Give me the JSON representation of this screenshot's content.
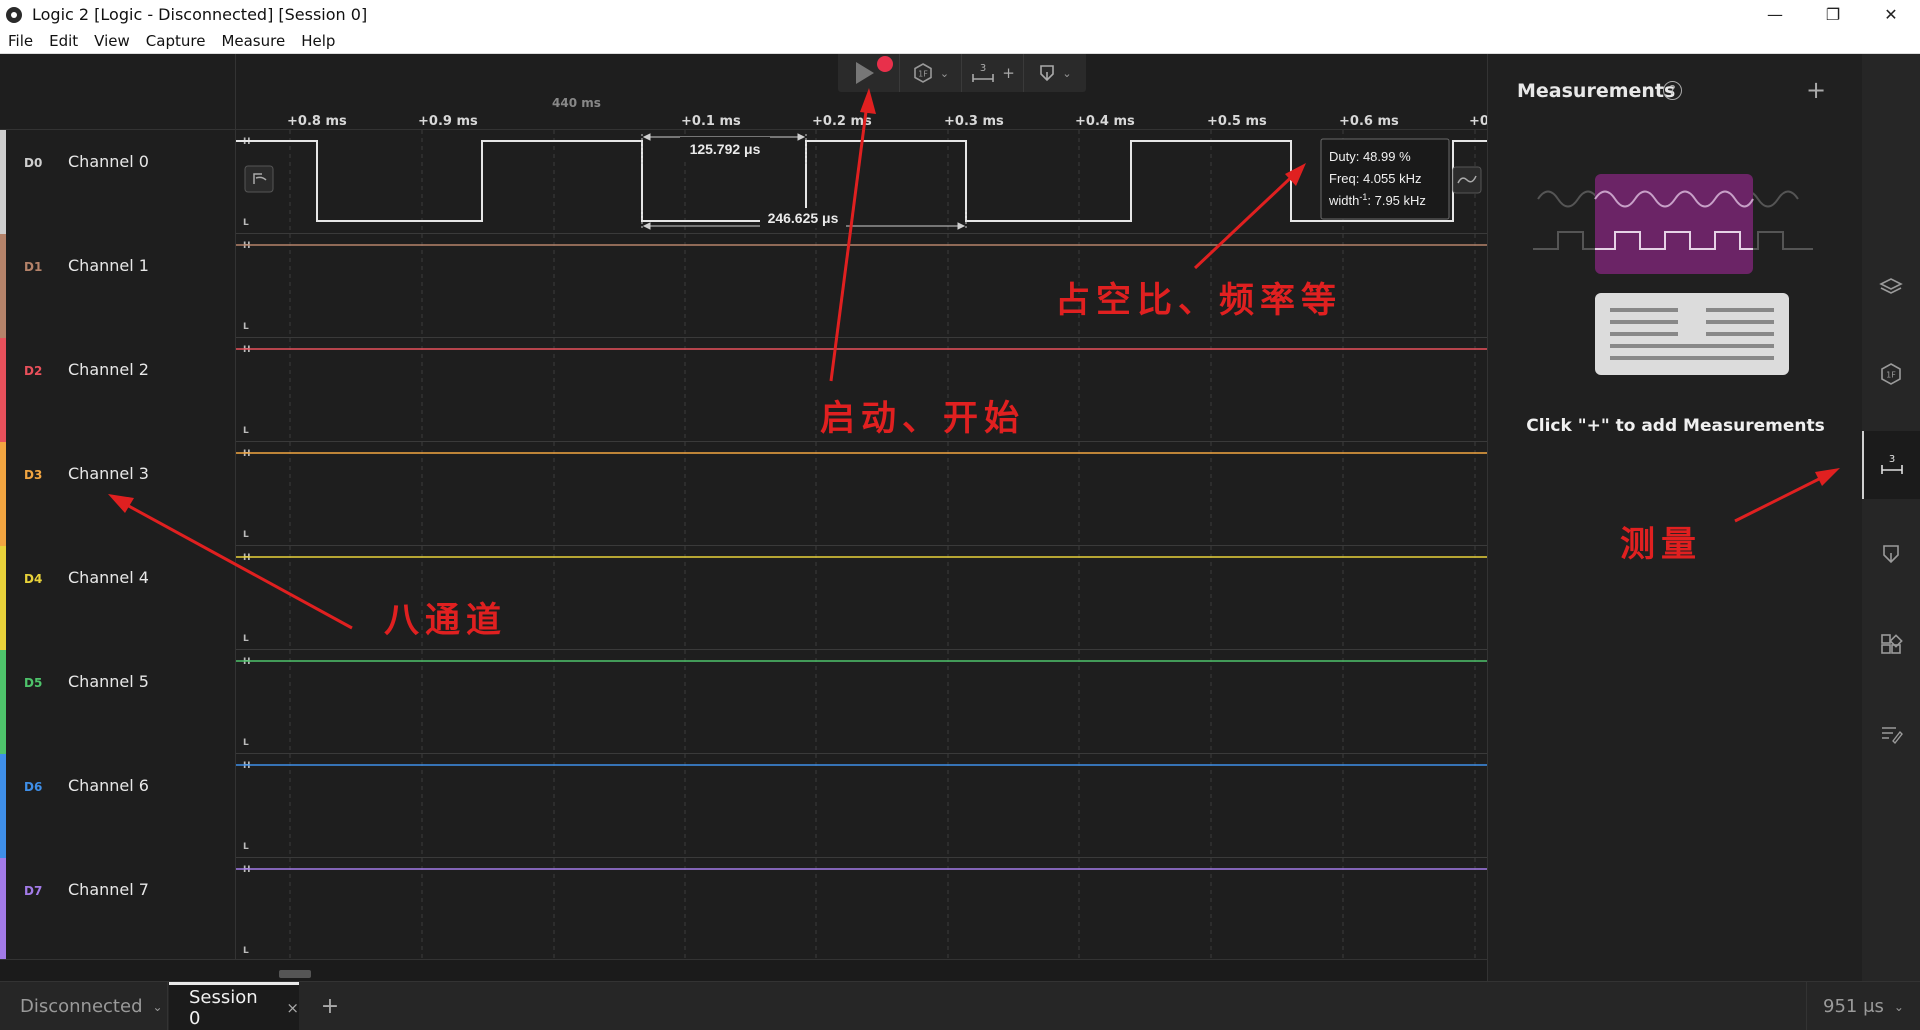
{
  "window": {
    "title": "Logic 2 [Logic - Disconnected] [Session 0]",
    "minimize": "—",
    "restore": "❐",
    "close": "✕"
  },
  "menu": [
    "File",
    "Edit",
    "View",
    "Capture",
    "Measure",
    "Help"
  ],
  "timeline": {
    "center_label": "440 ms",
    "ticks": [
      "+0.8 ms",
      "+0.9 ms",
      "+0.1 ms",
      "+0.2 ms",
      "+0.3 ms",
      "+0.4 ms",
      "+0.5 ms",
      "+0.6 ms",
      "+0"
    ]
  },
  "toolbar": {
    "play_icon": "play-icon",
    "record_indicator": "record-dot",
    "trigger_label": "1F",
    "measure_count": "3",
    "measure_add": "+"
  },
  "channels": [
    {
      "id": "D0",
      "name": "Channel 0",
      "color": "#cfcfcf"
    },
    {
      "id": "D1",
      "name": "Channel 1",
      "color": "#b5836a"
    },
    {
      "id": "D2",
      "name": "Channel 2",
      "color": "#e8505b"
    },
    {
      "id": "D3",
      "name": "Channel 3",
      "color": "#f2a541"
    },
    {
      "id": "D4",
      "name": "Channel 4",
      "color": "#e8d23a"
    },
    {
      "id": "D5",
      "name": "Channel 5",
      "color": "#4ec46b"
    },
    {
      "id": "D6",
      "name": "Channel 6",
      "color": "#3f8fe8"
    },
    {
      "id": "D7",
      "name": "Channel 7",
      "color": "#a37be8"
    }
  ],
  "level_high": "H",
  "level_low": "L",
  "wave_annotations": {
    "pulse_width": "125.792 μs",
    "period": "246.625 μs",
    "tooltip_duty": "Duty: 48.99 %",
    "tooltip_freq": "Freq: 4.055 kHz",
    "tooltip_width": "width",
    "tooltip_width_sup": "-1",
    "tooltip_width_val": ": 7.95 kHz"
  },
  "panel": {
    "title": "Measurements",
    "help": "?",
    "add": "+",
    "hint": "Click \"+\" to add Measurements"
  },
  "bottom": {
    "device": "Disconnected",
    "session": "Session 0",
    "session_close": "×",
    "add_tab": "+",
    "duration": "951 μs"
  },
  "annotations": {
    "channels_note": "八通道",
    "start_note": "启动、开始",
    "duty_note": "占空比、频率等",
    "measure_note": "测量"
  },
  "colors": {
    "annotation": "#e02020",
    "record": "#e8304b",
    "illus_purple": "#6b2466"
  }
}
